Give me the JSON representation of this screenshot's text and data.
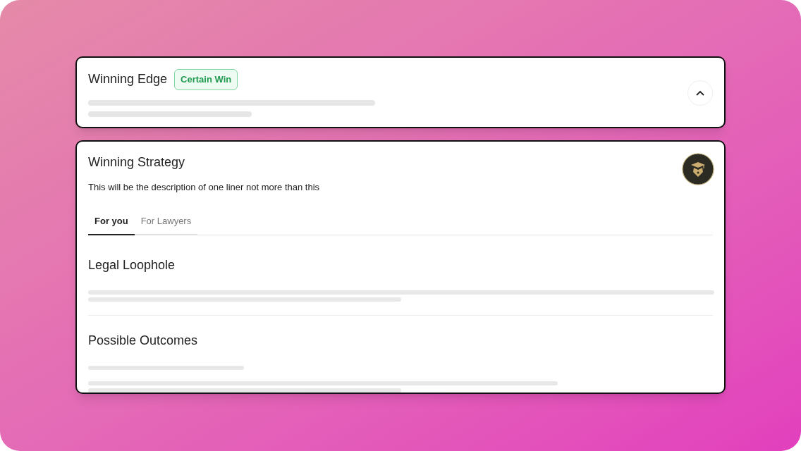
{
  "edge_card": {
    "title": "Winning Edge",
    "badge": "Certain Win",
    "expanded": true
  },
  "strategy_card": {
    "title": "Winning Strategy",
    "description": "This will be the description of one liner not more than this",
    "tabs": [
      {
        "label": "For you",
        "selected": true
      },
      {
        "label": "For Lawyers",
        "selected": false
      }
    ],
    "sections": [
      {
        "title": "Legal Loophole"
      },
      {
        "title": "Possible Outcomes"
      }
    ]
  }
}
